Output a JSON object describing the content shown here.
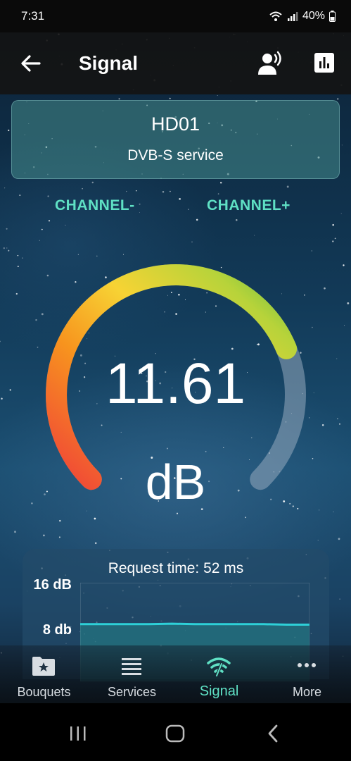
{
  "status_bar": {
    "time": "7:31",
    "battery": "40%"
  },
  "app_bar": {
    "title": "Signal"
  },
  "service": {
    "name": "HD01",
    "type": "DVB-S service"
  },
  "channel_controls": {
    "prev_label": "CHANNEL-",
    "next_label": "CHANNEL+"
  },
  "gauge": {
    "value": "11.61",
    "unit": "dB",
    "fill_fraction": 0.75
  },
  "request": {
    "text": "Request time: 52 ms",
    "y_labels": [
      "16 dB",
      "8 db"
    ],
    "chart_data": {
      "type": "area",
      "ylim": [
        0,
        20
      ],
      "yticks": [
        "16 dB",
        "8 db"
      ],
      "series": [
        {
          "values": [
            11.6,
            11.6,
            11.6,
            11.6,
            11.7,
            11.6,
            11.6,
            11.6,
            11.6,
            11.5,
            11.5
          ]
        }
      ]
    }
  },
  "bottom_nav": {
    "items": [
      {
        "label": "Bouquets",
        "icon": "star-folder-icon"
      },
      {
        "label": "Services",
        "icon": "list-icon"
      },
      {
        "label": "Signal",
        "icon": "signal-icon"
      },
      {
        "label": "More",
        "icon": "more-icon"
      }
    ],
    "active_index": 2
  },
  "colors": {
    "accent": "#5fe0c4",
    "gauge_red": "#f04438",
    "gauge_yellow": "#f7d334",
    "gauge_green": "#6bc043"
  }
}
